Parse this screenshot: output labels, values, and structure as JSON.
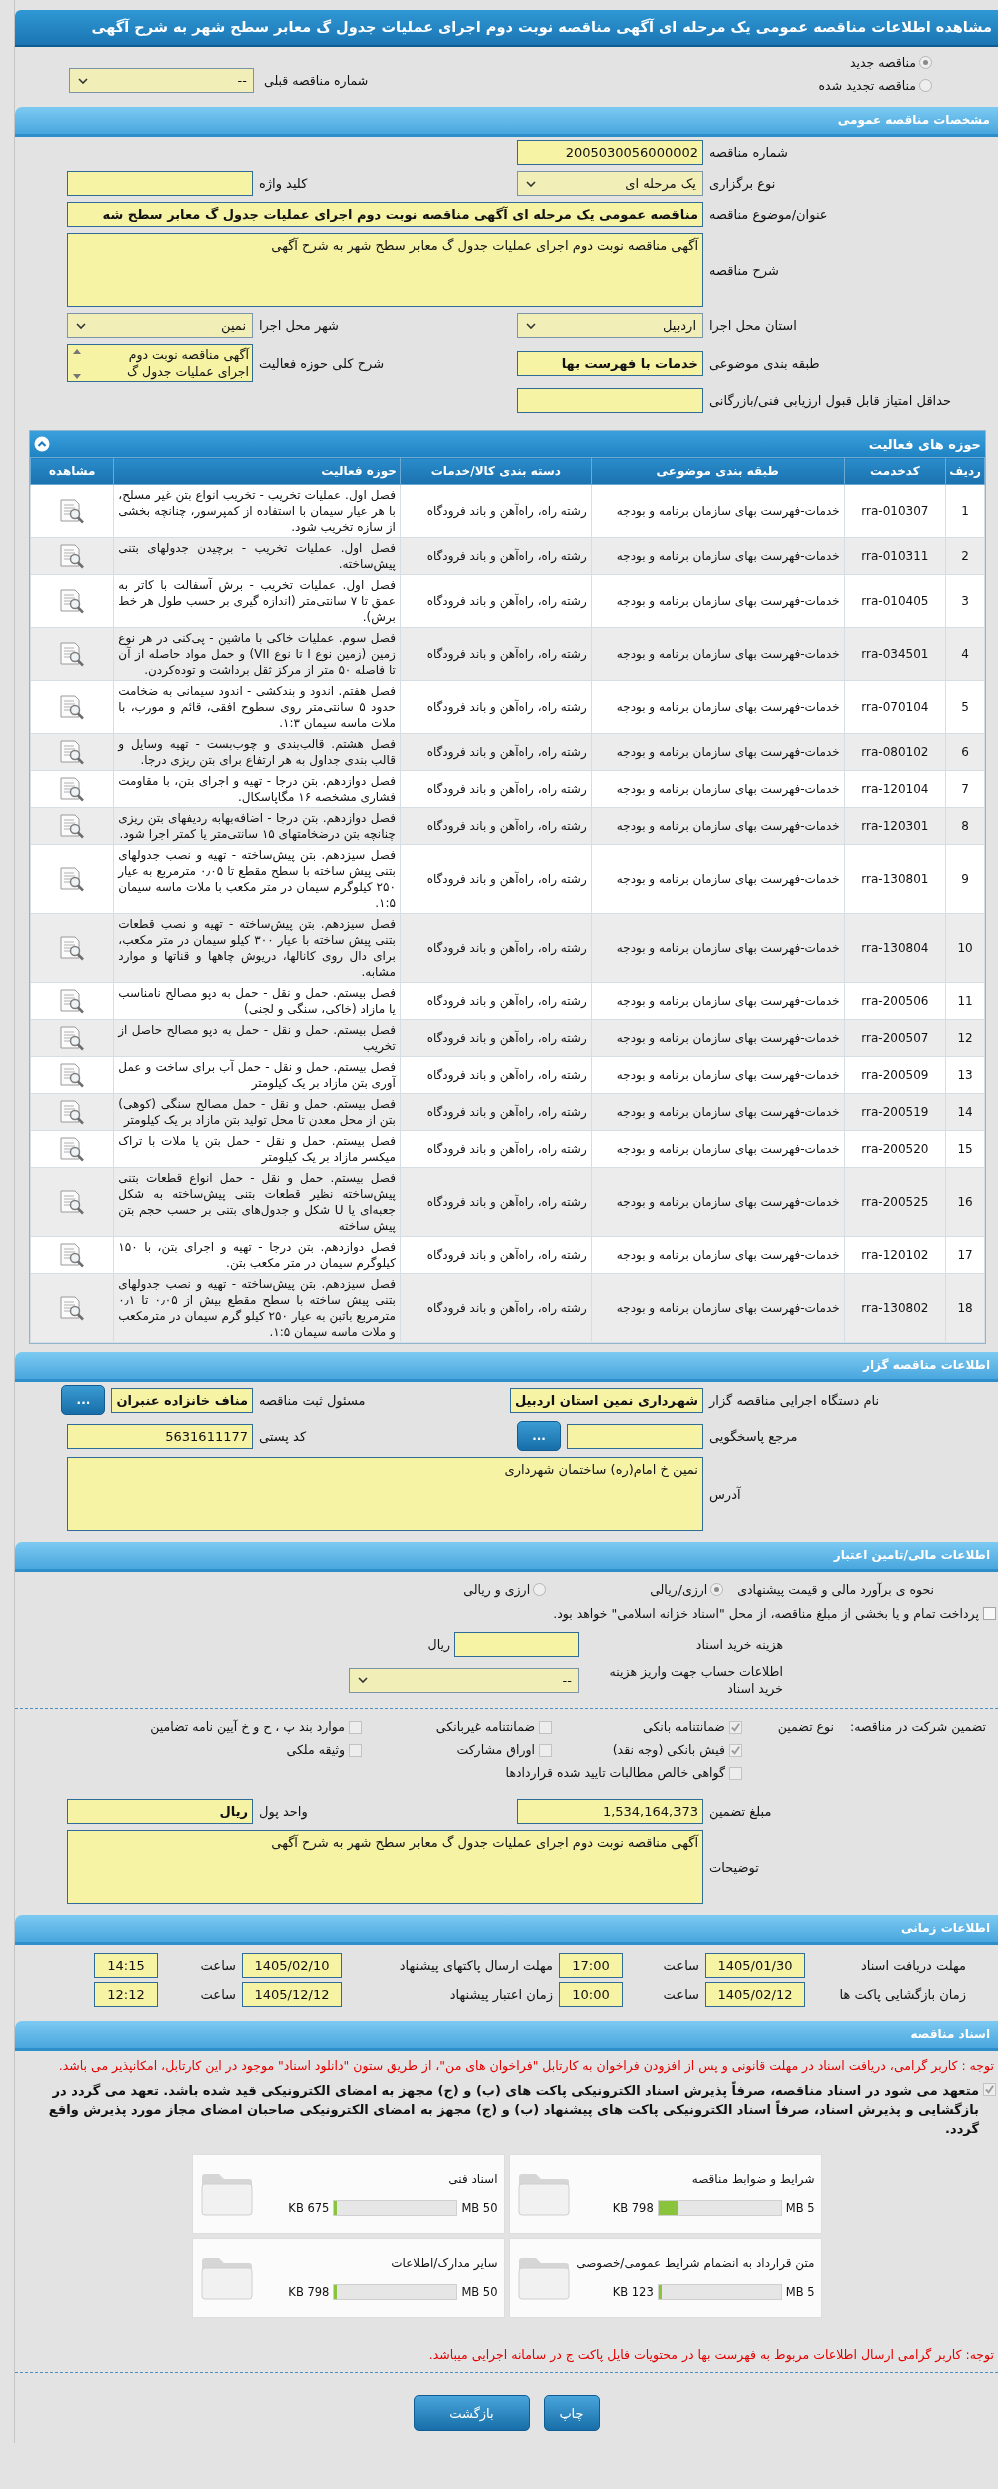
{
  "page_title": "مشاهده اطلاعات مناقصه عمومی یک مرحله ای آگهی مناقصه نوبت دوم اجرای عملیات جدول گ معابر سطح شهر به شرح آگهی",
  "tender_kinds": [
    {
      "label": "مناقصه جدید",
      "selected": true
    },
    {
      "label": "مناقصه تجدید شده",
      "selected": false
    }
  ],
  "previous_tender": {
    "label": "شماره مناقصه قبلی",
    "value": "--"
  },
  "sections": [
    {
      "kind": "form",
      "title": "مشخصات مناقصه عمومی",
      "rows": [
        {
          "fields": [
            {
              "label": "شماره مناقصه",
              "kind": "text",
              "value": "2005030056000002"
            }
          ]
        },
        {
          "fields": [
            {
              "label": "نوع برگزاری",
              "kind": "select",
              "value": "یک مرحله ای"
            },
            {
              "label": "کلید واژه",
              "kind": "text"
            }
          ]
        },
        {
          "fields": [
            {
              "label": "عنوان/موضوع مناقصه",
              "kind": "long-text",
              "bold": true,
              "value": "مناقصه عمومی یک مرحله ای آگهی مناقصه نوبت دوم اجرای عملیات جدول گ معابر سطح شه"
            }
          ]
        },
        {
          "fields": [
            {
              "label": "شرح مناقصه",
              "kind": "textarea",
              "value": "آگهی مناقصه نوبت دوم اجرای عملیات جدول گ معابر سطح شهر به شرح آگهی"
            }
          ]
        },
        {
          "fields": [
            {
              "label": "استان محل اجرا",
              "kind": "select",
              "value": "اردبیل"
            },
            {
              "label": "شهر محل اجرا",
              "kind": "select",
              "value": "نمین"
            }
          ]
        },
        {
          "fields": [
            {
              "label": "طبقه بندی موضوعی",
              "kind": "text",
              "bold": true,
              "value": "خدمات با فهرست بها"
            },
            {
              "label": "شرح کلی حوزه فعالیت",
              "kind": "listbox",
              "value": "آگهی مناقصه نوبت دوم اجرای عملیات جدول گ"
            }
          ]
        },
        {
          "fields": [
            {
              "label": "حداقل امتیاز قابل قبول ارزیابی فنی/بازرگانی",
              "kind": "text"
            }
          ]
        }
      ]
    },
    {
      "kind": "table",
      "title": "حوزه های فعالیت",
      "columns": [
        "ردیف",
        "کدخدمت",
        "طبقه بندی موضوعی",
        "دسته بندی کالا/خدمات",
        "حوزه فعالیت",
        "مشاهده"
      ],
      "rows": [
        {
          "index": "1",
          "code": "rra-010307",
          "category": "خدمات-فهرست بهای سازمان برنامه و بودجه",
          "goods_category": "رشته راه، راه‌آهن و باند فرودگاه",
          "activity": "فصل اول. عملیات تخریب - تخریب انواع بتن غیر مسلح، با هر عیار سیمان با استفاده از کمپرسور، چنانچه بخشی از سازه تخریب شود."
        },
        {
          "index": "2",
          "code": "rra-010311",
          "category": "خدمات-فهرست بهای سازمان برنامه و بودجه",
          "goods_category": "رشته راه، راه‌آهن و باند فرودگاه",
          "activity": "فصل اول. عملیات تخریب - برچیدن جدولهای بتنی پیش‌ساخته."
        },
        {
          "index": "3",
          "code": "rra-010405",
          "category": "خدمات-فهرست بهای سازمان برنامه و بودجه",
          "goods_category": "رشته راه، راه‌آهن و باند فرودگاه",
          "activity": "فصل اول. عملیات تخریب - برش آسفالت با کاتر به عمق تا ۷ سانتی‌متر (اندازه گیری بر حسب طول هر خط برش)."
        },
        {
          "index": "4",
          "code": "rra-034501",
          "category": "خدمات-فهرست بهای سازمان برنامه و بودجه",
          "goods_category": "رشته راه، راه‌آهن و باند فرودگاه",
          "activity": "فصل سوم. عملیات خاکی با ماشین - پی‌کنی در هر نوع زمین (زمین نوع I تا نوع VII) و حمل مواد حاصله از آن تا فاصله ۵۰ متر از مرکز ثقل برداشت و توده‌کردن."
        },
        {
          "index": "5",
          "code": "rra-070104",
          "category": "خدمات-فهرست بهای سازمان برنامه و بودجه",
          "goods_category": "رشته راه، راه‌آهن و باند فرودگاه",
          "activity": "فصل هفتم. اندود و بندکشی - اندود سیمانی به ضخامت حدود ۵ سانتی‌متر روی سطوح افقی، قائم و مورب، با ملات ماسه سیمان ۱:۳."
        },
        {
          "index": "6",
          "code": "rra-080102",
          "category": "خدمات-فهرست بهای سازمان برنامه و بودجه",
          "goods_category": "رشته راه، راه‌آهن و باند فرودگاه",
          "activity": "فصل هشتم. قالب‌بندی و چوب‌بست - تهیه وسایل و قالب بندی جداول به هر ارتفاع برای بتن ریزی درجا."
        },
        {
          "index": "7",
          "code": "rra-120104",
          "category": "خدمات-فهرست بهای سازمان برنامه و بودجه",
          "goods_category": "رشته راه، راه‌آهن و باند فرودگاه",
          "activity": "فصل دوازدهم. بتن درجا - تهیه و اجرای بتن، با مقاومت فشاری مشخصه ۱۶ مگاپاسکال."
        },
        {
          "index": "8",
          "code": "rra-120301",
          "category": "خدمات-فهرست بهای سازمان برنامه و بودجه",
          "goods_category": "رشته راه، راه‌آهن و باند فرودگاه",
          "activity": "فصل دوازدهم. بتن درجا - اضافه‌بهابه ردیفهای بتن ریزی چنانچه بتن درضخامتهای ۱۵ سانتی‌متر یا کمتر اجرا شود."
        },
        {
          "index": "9",
          "code": "rra-130801",
          "category": "خدمات-فهرست بهای سازمان برنامه و بودجه",
          "goods_category": "رشته راه، راه‌آهن و باند فرودگاه",
          "activity": "فصل سیزدهم. بتن پیش‌ساخته - تهیه و نصب جدولهای بتنی پیش ساخته با سطح مقطع تا ۰٫۰۵ مترمربع به عیار ۲۵۰ کیلوگرم سیمان در متر مکعب با ملات ماسه سیمان ۱:۵."
        },
        {
          "index": "10",
          "code": "rra-130804",
          "category": "خدمات-فهرست بهای سازمان برنامه و بودجه",
          "goods_category": "رشته راه، راه‌آهن و باند فرودگاه",
          "activity": "فصل سیزدهم. بتن پیش‌ساخته - تهیه و نصب قطعات بتنی پیش ساخته با عیار ۳۰۰ کیلو سیمان در متر مکعب، برای دال روی کانالها، دریوش چاهها و قناتها و موارد مشابه."
        },
        {
          "index": "11",
          "code": "rra-200506",
          "category": "خدمات-فهرست بهای سازمان برنامه و بودجه",
          "goods_category": "رشته راه، راه‌آهن و باند فرودگاه",
          "activity": "فصل بیستم. حمل و نقل - حمل به دپو مصالح نامناسب یا مازاد (خاکی، سنگی و لجنی)"
        },
        {
          "index": "12",
          "code": "rra-200507",
          "category": "خدمات-فهرست بهای سازمان برنامه و بودجه",
          "goods_category": "رشته راه، راه‌آهن و باند فرودگاه",
          "activity": "فصل بیستم. حمل و نقل - حمل به دپو مصالح حاصل از تخریب"
        },
        {
          "index": "13",
          "code": "rra-200509",
          "category": "خدمات-فهرست بهای سازمان برنامه و بودجه",
          "goods_category": "رشته راه، راه‌آهن و باند فرودگاه",
          "activity": "فصل بیستم. حمل و نقل - حمل آب برای ساخت و عمل آوری بتن مازاد بر یک کیلومتر"
        },
        {
          "index": "14",
          "code": "rra-200519",
          "category": "خدمات-فهرست بهای سازمان برنامه و بودجه",
          "goods_category": "رشته راه، راه‌آهن و باند فرودگاه",
          "activity": "فصل بیستم. حمل و نقل - حمل مصالح سنگی (کوهی) بتن از محل معدن تا محل تولید بتن مازاد بر یک کیلومتر"
        },
        {
          "index": "15",
          "code": "rra-200520",
          "category": "خدمات-فهرست بهای سازمان برنامه و بودجه",
          "goods_category": "رشته راه، راه‌آهن و باند فرودگاه",
          "activity": "فصل بیستم. حمل و نقل - حمل بتن یا ملات با تراک میکسر مازاد بر یک کیلومتر"
        },
        {
          "index": "16",
          "code": "rra-200525",
          "category": "خدمات-فهرست بهای سازمان برنامه و بودجه",
          "goods_category": "رشته راه، راه‌آهن و باند فرودگاه",
          "activity": "فصل بیستم. حمل و نقل - حمل انواع قطعات بتنی پیش‌ساخته نظیر قطعات بتنی پیش‌ساخته به شکل جعبه‌ای یا U شکل و جدول‌های بتنی بر حسب حجم بتن پیش ساخته"
        },
        {
          "index": "17",
          "code": "rra-120102",
          "category": "خدمات-فهرست بهای سازمان برنامه و بودجه",
          "goods_category": "رشته راه، راه‌آهن و باند فرودگاه",
          "activity": "فصل دوازدهم. بتن درجا - تهیه و اجرای بتن، با ۱۵۰ کیلوگرم سیمان در متر مکعب بتن."
        },
        {
          "index": "18",
          "code": "rra-130802",
          "category": "خدمات-فهرست بهای سازمان برنامه و بودجه",
          "goods_category": "رشته راه، راه‌آهن و باند فرودگاه",
          "activity": "فصل سیزدهم. بتن پیش‌ساخته - تهیه و نصب جدولهای بتنی پیش ساخته با سطح مقطع بیش از ۰٫۰۵ تا ۰٫۱ مترمربع باتبن به عیار ۲۵۰ کیلو گرم سیمان در مترمکعب و ملات ماسه سیمان ۱:۵."
        }
      ]
    },
    {
      "kind": "form",
      "title": "اطلاعات مناقصه گزار",
      "rows": [
        {
          "fields": [
            {
              "label": "نام دستگاه اجرایی مناقصه گزار",
              "kind": "text",
              "bold": true,
              "value": "شهرداری نمین استان اردبیل"
            },
            {
              "label": "مسئول ثبت مناقصه",
              "kind": "text",
              "bold": true,
              "value": "مناف خانزاده عنبران",
              "button": "..."
            }
          ]
        },
        {
          "fields": [
            {
              "label": "مرجع پاسخگویی",
              "kind": "text",
              "button": "..."
            },
            {
              "label": "کد پستی",
              "kind": "text",
              "value": "5631611177"
            }
          ]
        },
        {
          "fields": [
            {
              "label": "آدرس",
              "kind": "textarea",
              "value": "نمین خ امام(ره) ساختمان شهرداری"
            }
          ]
        }
      ]
    },
    {
      "kind": "finance",
      "title": "اطلاعات مالی/تامین اعتبار",
      "estimate": {
        "label": "نحوه ی برآورد مالی و قیمت پیشنهادی",
        "options": [
          {
            "label": "ارزی/ریالی",
            "selected": true
          },
          {
            "label": "ارزی و ریالی",
            "selected": false
          }
        ]
      },
      "treasury": {
        "label": "پرداخت تمام و یا بخشی از مبلغ مناقصه، از محل \"اسناد خزانه اسلامی\" خواهد بود.",
        "checked": false
      },
      "document_cost": {
        "label": "هزینه خرید اسناد",
        "unit": "ریال"
      },
      "account": {
        "label": "اطلاعات حساب جهت واریز هزینه خرید اسناد",
        "value": "--"
      },
      "guarantee": {
        "label": "تضمین شرکت در مناقصه:",
        "type_label": "نوع تضمین",
        "options": [
          {
            "label": "ضمانتنامه بانکی",
            "checked": true
          },
          {
            "label": "ضمانتنامه غیربانکی",
            "checked": false
          },
          {
            "label": "موارد بند پ ، ح و خ آیین نامه تضامین",
            "checked": false
          },
          {
            "label": "فیش بانکی (وجه نقد)",
            "checked": true
          },
          {
            "label": "اوراق مشارکت",
            "checked": false
          },
          {
            "label": "وثیقه ملکی",
            "checked": false
          },
          {
            "label": "گواهی خالص مطالبات تایید شده قراردادها",
            "checked": false
          }
        ]
      },
      "rows": [
        {
          "fields": [
            {
              "label": "مبلغ تضمین",
              "kind": "text",
              "value": "1,534,164,373"
            },
            {
              "label": "واحد پول",
              "kind": "text",
              "bold": true,
              "value": "ریال"
            }
          ]
        },
        {
          "fields": [
            {
              "label": "توضیحات",
              "kind": "textarea",
              "value": "آگهی مناقصه نوبت دوم اجرای عملیات جدول گ معابر سطح شهر به شرح آگهی"
            }
          ]
        }
      ]
    },
    {
      "kind": "schedule",
      "title": "اطلاعات زمانی",
      "items": [
        {
          "label": "مهلت دریافت اسناد",
          "date": "1405/01/30",
          "time_label": "ساعت",
          "time": "17:00"
        },
        {
          "label": "مهلت ارسال پاکتهای پیشنهاد",
          "date": "1405/02/10",
          "time_label": "ساعت",
          "time": "14:15"
        },
        {
          "label": "زمان بازگشایی پاکت ها",
          "date": "1405/02/12",
          "time_label": "ساعت",
          "time": "10:00"
        },
        {
          "label": "زمان اعتبار پیشنهاد",
          "date": "1405/12/12",
          "time_label": "ساعت",
          "time": "12:12"
        }
      ]
    },
    {
      "kind": "documents",
      "title": "اسناد مناقصه",
      "notice": "توجه : کاربر گرامی، دریافت اسناد در مهلت قانونی و پس از افزودن فراخوان به کارتابل \"فراخوان های من\"، از طریق ستون \"دانلود اسناد\" موجود در این کارتابل، امکانپذیر می باشد.",
      "commitment": {
        "text": "متعهد می شود در اسناد مناقصه، صرفاً پذیرش اسناد الکترونیکی پاکت های (ب) و (ج) مجهز به امضای الکترونیکی قید شده باشد. تعهد می گردد در بازگشایی و پذیرش اسناد، صرفاً اسناد الکترونیکی پاکت های پیشنهاد (ب) و (ج) مجهز به امضای الکترونیکی صاحبان امضای مجاز مورد پذیرش واقع گردد.",
        "checked": true
      },
      "files": [
        {
          "name": "شرایط و ضوابط مناقصه",
          "size": "798 KB",
          "limit": "5 MB",
          "level": 0.16
        },
        {
          "name": "اسناد فنی",
          "size": "675 KB",
          "limit": "50 MB",
          "level": 0.02
        },
        {
          "name": "متن قرارداد به انضمام شرایط عمومی/خصوصی",
          "size": "123 KB",
          "limit": "5 MB",
          "level": 0.03
        },
        {
          "name": "سایر مدارک/اطلاعات",
          "size": "798 KB",
          "limit": "50 MB",
          "level": 0.02
        }
      ],
      "note": "توجه: کاربر گرامی ارسال اطلاعات مربوط به فهرست بها در محتویات فایل پاکت ج در سامانه اجرایی میباشد."
    }
  ],
  "buttons": [
    {
      "label": "چاپ"
    },
    {
      "label": "بازگشت"
    }
  ]
}
